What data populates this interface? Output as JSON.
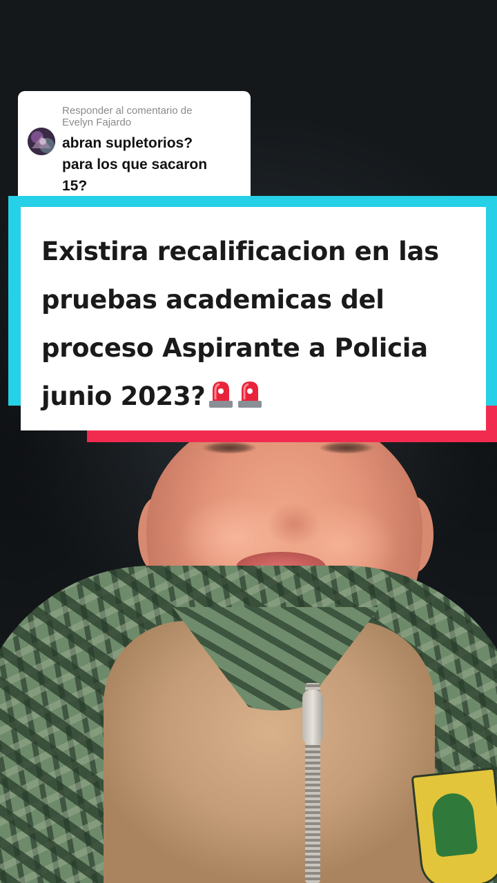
{
  "reply_comment": {
    "header_line1": "Responder al comentario de",
    "header_line2": "Evelyn Fajardo",
    "text_line1": "abran supletorios?",
    "text_line2": "para los que sacaron",
    "text_line3": "15?"
  },
  "title_card": {
    "line1": "Existira recalificacion en las",
    "line2": "pruebas academicas del",
    "line3": "proceso Aspirante a Policia",
    "line4": "junio 2023?"
  },
  "icons": {
    "siren": "police-siren-emoji",
    "avatar": "user-avatar"
  },
  "colors": {
    "accent_cyan": "#26d0e6",
    "accent_red": "#f12b4f",
    "card_bg": "#ffffff"
  }
}
